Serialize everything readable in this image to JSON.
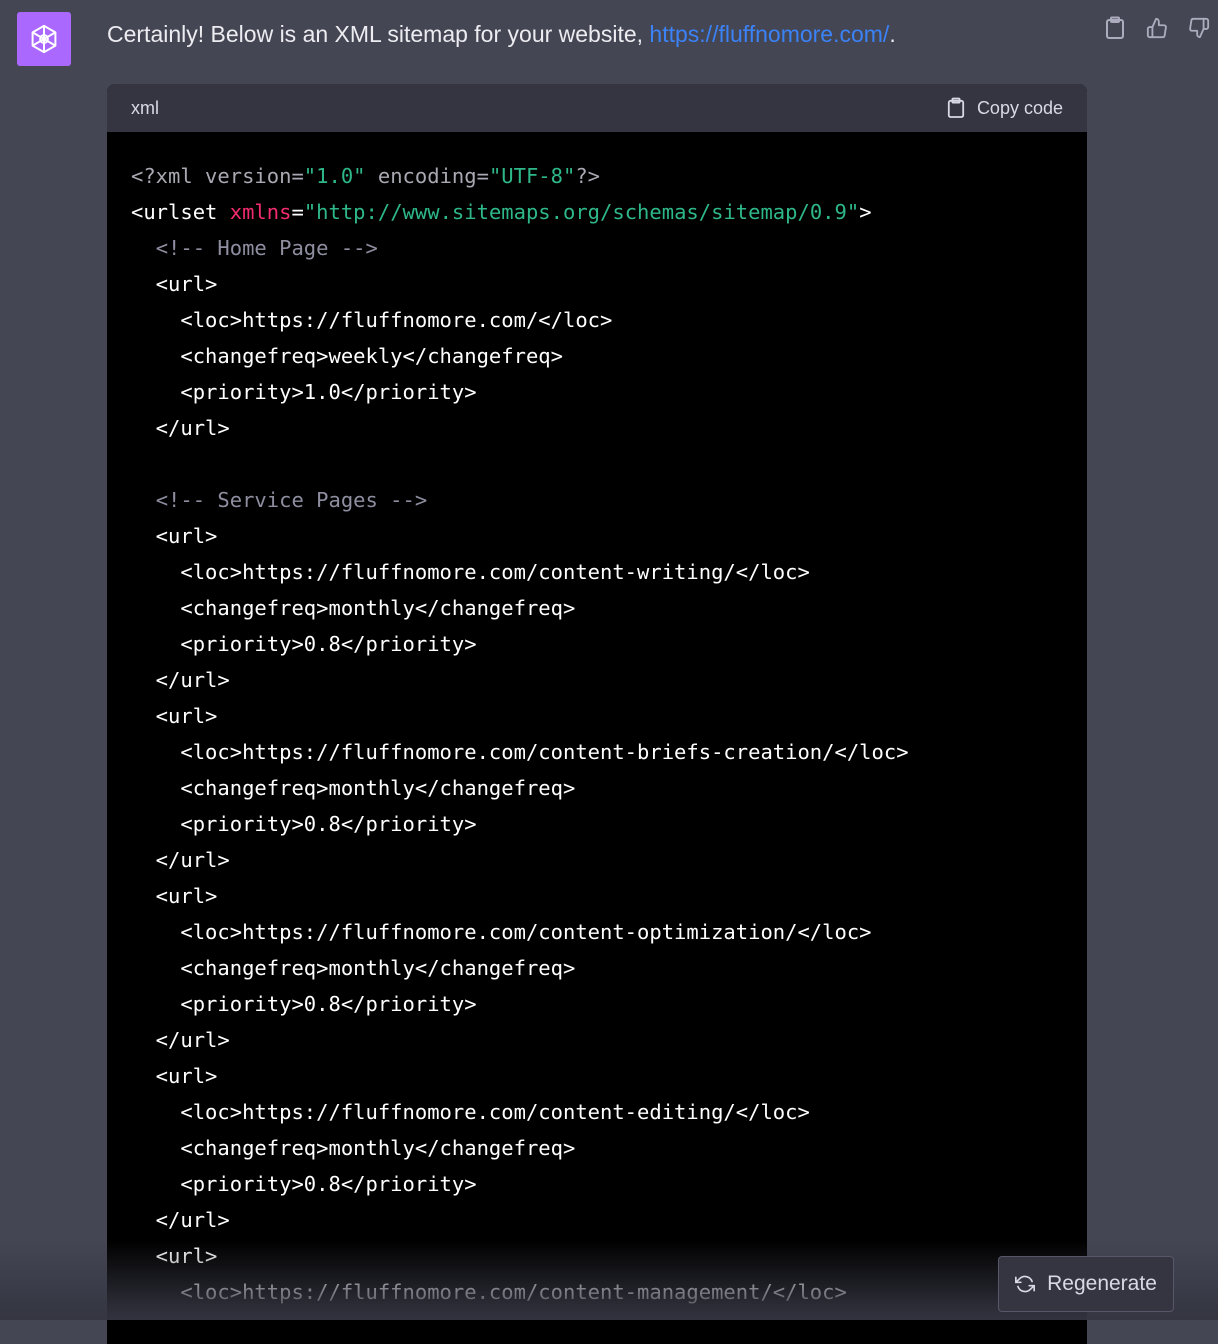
{
  "message": {
    "text_prefix": "Certainly! Below is an XML sitemap for your website, ",
    "link_text": "https://fluffnomore.com/",
    "text_suffix": "."
  },
  "actions": {
    "copy_icon": "clipboard-icon",
    "like_icon": "thumbs-up-icon",
    "dislike_icon": "thumbs-down-icon"
  },
  "code_block": {
    "language": "xml",
    "copy_label": "Copy code",
    "lines": [
      [
        {
          "t": "meta",
          "v": "<?xml version="
        },
        {
          "t": "str",
          "v": "\"1.0\""
        },
        {
          "t": "meta",
          "v": " encoding="
        },
        {
          "t": "str",
          "v": "\"UTF-8\""
        },
        {
          "t": "meta",
          "v": "?>"
        }
      ],
      [
        {
          "t": "plain",
          "v": "<urlset "
        },
        {
          "t": "attr",
          "v": "xmlns"
        },
        {
          "t": "plain",
          "v": "="
        },
        {
          "t": "str",
          "v": "\"http://www.sitemaps.org/schemas/sitemap/0.9\""
        },
        {
          "t": "plain",
          "v": ">"
        }
      ],
      [
        {
          "t": "plain",
          "v": "  "
        },
        {
          "t": "comment",
          "v": "<!-- Home Page -->"
        }
      ],
      [
        {
          "t": "plain",
          "v": "  <url>"
        }
      ],
      [
        {
          "t": "plain",
          "v": "    <loc>https://fluffnomore.com/</loc>"
        }
      ],
      [
        {
          "t": "plain",
          "v": "    <changefreq>weekly</changefreq>"
        }
      ],
      [
        {
          "t": "plain",
          "v": "    <priority>1.0</priority>"
        }
      ],
      [
        {
          "t": "plain",
          "v": "  </url>"
        }
      ],
      [],
      [
        {
          "t": "plain",
          "v": "  "
        },
        {
          "t": "comment",
          "v": "<!-- Service Pages -->"
        }
      ],
      [
        {
          "t": "plain",
          "v": "  <url>"
        }
      ],
      [
        {
          "t": "plain",
          "v": "    <loc>https://fluffnomore.com/content-writing/</loc>"
        }
      ],
      [
        {
          "t": "plain",
          "v": "    <changefreq>monthly</changefreq>"
        }
      ],
      [
        {
          "t": "plain",
          "v": "    <priority>0.8</priority>"
        }
      ],
      [
        {
          "t": "plain",
          "v": "  </url>"
        }
      ],
      [
        {
          "t": "plain",
          "v": "  <url>"
        }
      ],
      [
        {
          "t": "plain",
          "v": "    <loc>https://fluffnomore.com/content-briefs-creation/</loc>"
        }
      ],
      [
        {
          "t": "plain",
          "v": "    <changefreq>monthly</changefreq>"
        }
      ],
      [
        {
          "t": "plain",
          "v": "    <priority>0.8</priority>"
        }
      ],
      [
        {
          "t": "plain",
          "v": "  </url>"
        }
      ],
      [
        {
          "t": "plain",
          "v": "  <url>"
        }
      ],
      [
        {
          "t": "plain",
          "v": "    <loc>https://fluffnomore.com/content-optimization/</loc>"
        }
      ],
      [
        {
          "t": "plain",
          "v": "    <changefreq>monthly</changefreq>"
        }
      ],
      [
        {
          "t": "plain",
          "v": "    <priority>0.8</priority>"
        }
      ],
      [
        {
          "t": "plain",
          "v": "  </url>"
        }
      ],
      [
        {
          "t": "plain",
          "v": "  <url>"
        }
      ],
      [
        {
          "t": "plain",
          "v": "    <loc>https://fluffnomore.com/content-editing/</loc>"
        }
      ],
      [
        {
          "t": "plain",
          "v": "    <changefreq>monthly</changefreq>"
        }
      ],
      [
        {
          "t": "plain",
          "v": "    <priority>0.8</priority>"
        }
      ],
      [
        {
          "t": "plain",
          "v": "  </url>"
        }
      ],
      [
        {
          "t": "plain",
          "v": "  <url>"
        }
      ],
      [
        {
          "t": "plain",
          "v": "    <loc>https://fluffnomore.com/content-management/</loc>"
        }
      ]
    ]
  },
  "regenerate": {
    "label": "Regenerate",
    "icon": "refresh-icon"
  }
}
